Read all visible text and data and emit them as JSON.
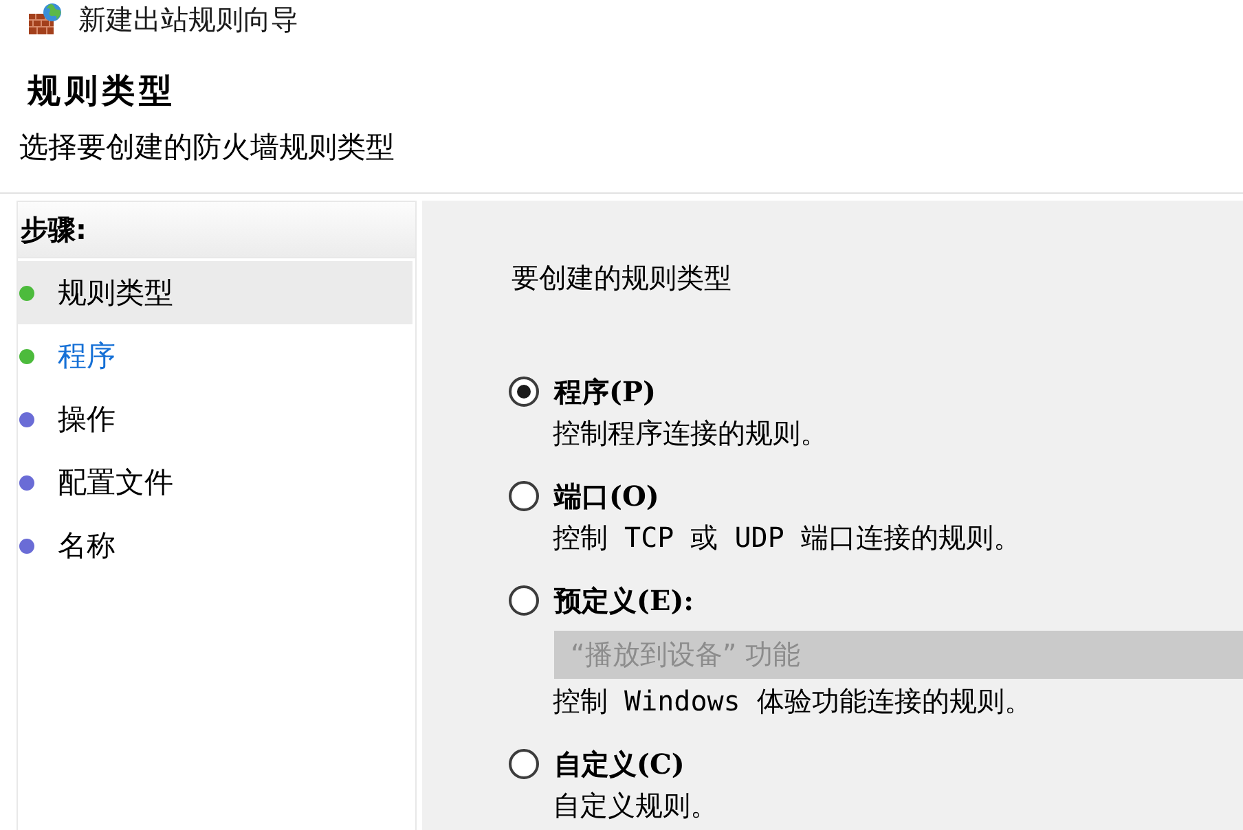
{
  "window": {
    "title": "新建出站规则向导"
  },
  "header": {
    "title": "规则类型",
    "subtitle": "选择要创建的防火墙规则类型"
  },
  "steps": {
    "heading": "步骤:",
    "items": [
      {
        "label": "规则类型",
        "selected": true,
        "hovered": false,
        "color": "#4cbb3c"
      },
      {
        "label": "程序",
        "selected": false,
        "hovered": true,
        "color": "#4cbb3c"
      },
      {
        "label": "操作",
        "selected": false,
        "hovered": false,
        "color": "#6a6cd6"
      },
      {
        "label": "配置文件",
        "selected": false,
        "hovered": false,
        "color": "#6a6cd6"
      },
      {
        "label": "名称",
        "selected": false,
        "hovered": false,
        "color": "#6a6cd6"
      }
    ]
  },
  "content": {
    "prompt": "要创建的规则类型",
    "options": [
      {
        "label": "程序(P)",
        "selected": true,
        "description": "控制程序连接的规则。"
      },
      {
        "label": "端口(O)",
        "selected": false,
        "description": "控制 TCP 或 UDP 端口连接的规则。"
      },
      {
        "label": "预定义(E):",
        "selected": false,
        "dropdown": {
          "value": "“播放到设备” 功能",
          "disabled": true
        },
        "description": "控制 Windows 体验功能连接的规则。"
      },
      {
        "label": "自定义(C)",
        "selected": false,
        "description": "自定义规则。"
      }
    ]
  }
}
